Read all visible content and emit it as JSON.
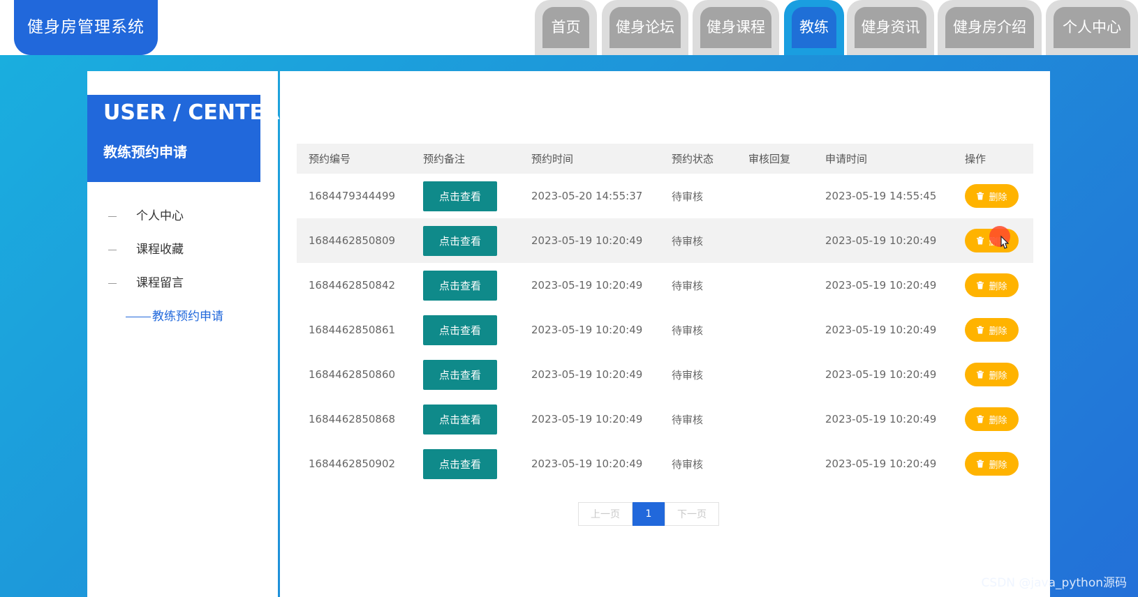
{
  "app": {
    "title": "健身房管理系统"
  },
  "nav": {
    "tabs": [
      {
        "label": "首页"
      },
      {
        "label": "健身论坛"
      },
      {
        "label": "健身课程"
      },
      {
        "label": "教练",
        "active": true
      },
      {
        "label": "健身资讯"
      },
      {
        "label": "健身房介绍"
      },
      {
        "label": "个人中心"
      }
    ]
  },
  "sidebar": {
    "title": "USER / CENTER",
    "subtitle": "教练预约申请",
    "items": [
      {
        "label": "个人中心"
      },
      {
        "label": "课程收藏"
      },
      {
        "label": "课程留言"
      },
      {
        "label": "教练预约申请",
        "active": true
      }
    ]
  },
  "table": {
    "headers": [
      "预约编号",
      "预约备注",
      "预约时间",
      "预约状态",
      "审核回复",
      "申请时间",
      "操作"
    ],
    "view_label": "点击查看",
    "delete_label": "删除",
    "rows": [
      {
        "id": "1684479344499",
        "time": "2023-05-20 14:55:37",
        "status": "待审核",
        "reply": "",
        "apply_time": "2023-05-19 14:55:45"
      },
      {
        "id": "1684462850809",
        "time": "2023-05-19 10:20:49",
        "status": "待审核",
        "reply": "",
        "apply_time": "2023-05-19 10:20:49"
      },
      {
        "id": "1684462850842",
        "time": "2023-05-19 10:20:49",
        "status": "待审核",
        "reply": "",
        "apply_time": "2023-05-19 10:20:49"
      },
      {
        "id": "1684462850861",
        "time": "2023-05-19 10:20:49",
        "status": "待审核",
        "reply": "",
        "apply_time": "2023-05-19 10:20:49"
      },
      {
        "id": "1684462850860",
        "time": "2023-05-19 10:20:49",
        "status": "待审核",
        "reply": "",
        "apply_time": "2023-05-19 10:20:49"
      },
      {
        "id": "1684462850868",
        "time": "2023-05-19 10:20:49",
        "status": "待审核",
        "reply": "",
        "apply_time": "2023-05-19 10:20:49"
      },
      {
        "id": "1684462850902",
        "time": "2023-05-19 10:20:49",
        "status": "待审核",
        "reply": "",
        "apply_time": "2023-05-19 10:20:49"
      }
    ]
  },
  "pagination": {
    "prev": "上一页",
    "current": "1",
    "next": "下一页"
  },
  "watermark": "CSDN @java_python源码",
  "colors": {
    "primary": "#2168db",
    "view_button": "#0f8a8a",
    "delete_button": "#ffb300"
  }
}
